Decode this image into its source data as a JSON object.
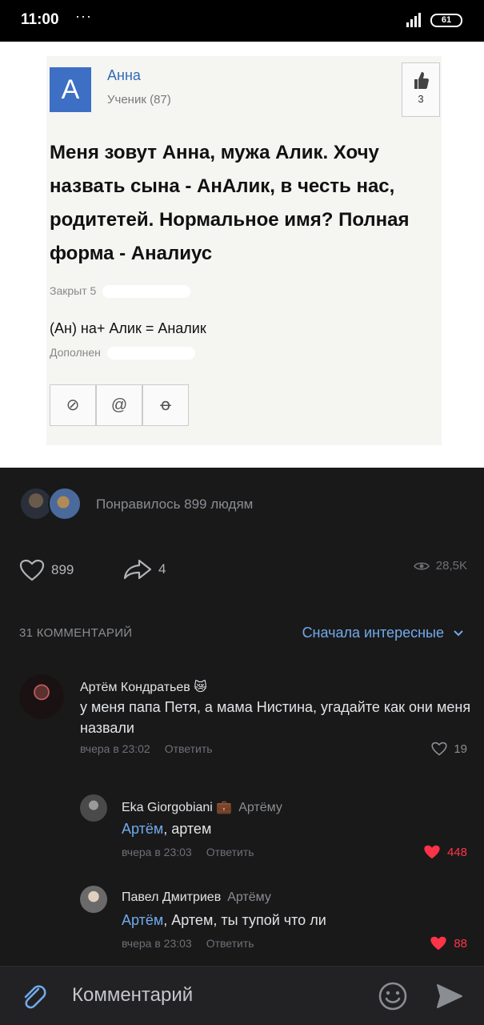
{
  "status_bar": {
    "time": "11:00",
    "dots": "···",
    "battery": "61"
  },
  "post": {
    "qa": {
      "avatar_letter": "А",
      "author": "Анна",
      "rank": "Ученик (87)",
      "like_count": "3",
      "question": "Меня зовут Анна, мужа Алик. Хочу назвать сына - АнАлик, в честь нас, родитетей. Нормальное имя? Полная форма - Аналиус",
      "closed_label": "Закрыт 5",
      "addition": "(Ан) на+ Алик = Аналик",
      "added_label": "Дополнен"
    },
    "liked_by": "Понравилось 899 людям",
    "likes": "899",
    "shares": "4",
    "views": "28,5K"
  },
  "comments_section": {
    "count_label": "31 КОММЕНТАРИЙ",
    "sort_label": "Сначала интересные"
  },
  "comments": [
    {
      "author": "Артём Кондратьев 😿",
      "text": "у меня папа Петя, а мама Нистина, угадайте как они меня назвали",
      "time": "вчера в 23:02",
      "reply": "Ответить",
      "likes": "19"
    },
    {
      "author": "Eka Giorgobiani 💼",
      "reply_to": "Артёму",
      "mention": "Артём",
      "text": ", артем",
      "time": "вчера в 23:03",
      "reply": "Ответить",
      "likes": "448"
    },
    {
      "author": "Павел Дмитриев",
      "reply_to": "Артёму",
      "mention": "Артём",
      "text": ", Артем, ты тупой что ли",
      "time": "вчера в 23:03",
      "reply": "Ответить",
      "likes": "88"
    }
  ],
  "composer": {
    "placeholder": "Комментарий"
  },
  "colors": {
    "accent": "#71aaeb",
    "liked": "#ff3347",
    "background": "#19191a"
  }
}
